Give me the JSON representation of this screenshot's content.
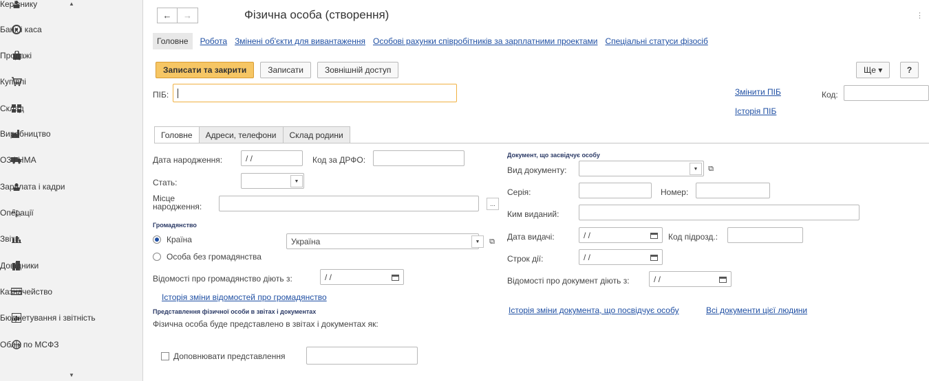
{
  "sidebar": {
    "items": [
      {
        "label": "Керівнику",
        "icon": "person-icon"
      },
      {
        "label": "Банк і каса",
        "icon": "coins-icon"
      },
      {
        "label": "Продажі",
        "icon": "shopping-bag-icon"
      },
      {
        "label": "Купівлі",
        "icon": "cart-icon"
      },
      {
        "label": "Склад",
        "icon": "warehouse-icon"
      },
      {
        "label": "Виробництво",
        "icon": "factory-icon"
      },
      {
        "label": "ОЗ і НМА",
        "icon": "truck-icon"
      },
      {
        "label": "Зарплата і кадри",
        "icon": "person-icon"
      },
      {
        "label": "Операції",
        "icon": "operations-icon"
      },
      {
        "label": "Звіти",
        "icon": "bar-chart-icon"
      },
      {
        "label": "Довідники",
        "icon": "books-icon"
      },
      {
        "label": "Казначейство",
        "icon": "treasury-icon"
      },
      {
        "label": "Бюджетування і звітність",
        "icon": "budget-icon"
      },
      {
        "label": "Облік по МСФЗ",
        "icon": "ifrs-icon"
      }
    ]
  },
  "header": {
    "title": "Фізична особа (створення)",
    "back": "←",
    "forward": "→",
    "more_dots": "⋮"
  },
  "nav_tabs": {
    "active": "Головне",
    "links": [
      "Робота",
      "Змінені об'єкти для вивантаження",
      "Особові рахунки співробітників за зарплатними проектами",
      "Спеціальні статуси фізосіб"
    ]
  },
  "toolbar": {
    "save_close": "Записати та закрити",
    "save": "Записати",
    "external": "Зовнішній доступ",
    "more": "Ще ▾",
    "help": "?"
  },
  "header_fields": {
    "pib_label": "ПІБ:",
    "pib_value": "",
    "change_pib": "Змінити ПІБ",
    "history_pib": "Історія ПІБ",
    "code_label": "Код:",
    "code_value": ""
  },
  "form_tabs": [
    "Головне",
    "Адреси, телефони",
    "Склад родини"
  ],
  "left": {
    "birth_date_label": "Дата народження:",
    "birth_date_value": " / /",
    "drfo_label": "Код за ДРФО:",
    "drfo_value": "",
    "sex_label": "Стать:",
    "sex_value": "",
    "birthplace_label_1": "Місце",
    "birthplace_label_2": "народження:",
    "birthplace_value": "",
    "birthplace_btn": "...",
    "citizenship_title": "Громадянство",
    "country_radio": "Країна",
    "country_value": "Україна",
    "stateless_radio": "Особа без громадянства",
    "citizenship_from_label": "Відомості про громадянство діють з:",
    "citizenship_from_value": " / /",
    "citizenship_history_link": "Історія зміни відомостей про громадянство",
    "representation_title": "Представлення фізичної особи в звітах і документах",
    "representation_text": "Фізична особа буде представлено в звітах і документах як:",
    "supplement_label": "Доповнювати представлення",
    "supplement_value": ""
  },
  "right": {
    "doc_title": "Документ, що засвідчує особу",
    "doc_type_label": "Вид документу:",
    "doc_type_value": "",
    "series_label": "Серія:",
    "series_value": "",
    "number_label": "Номер:",
    "number_value": "",
    "issued_by_label": "Ким виданий:",
    "issued_by_value": "",
    "issue_date_label": "Дата видачі:",
    "issue_date_value": " / /",
    "dept_code_label": "Код підрозд.:",
    "dept_code_value": "",
    "valid_label": "Строк дії:",
    "valid_value": " / /",
    "doc_from_label": "Відомості про документ діють з:",
    "doc_from_value": " / /",
    "doc_history_link": "Історія зміни документа, що посвідчує особу",
    "all_docs_link": "Всі документи цієї людини"
  }
}
